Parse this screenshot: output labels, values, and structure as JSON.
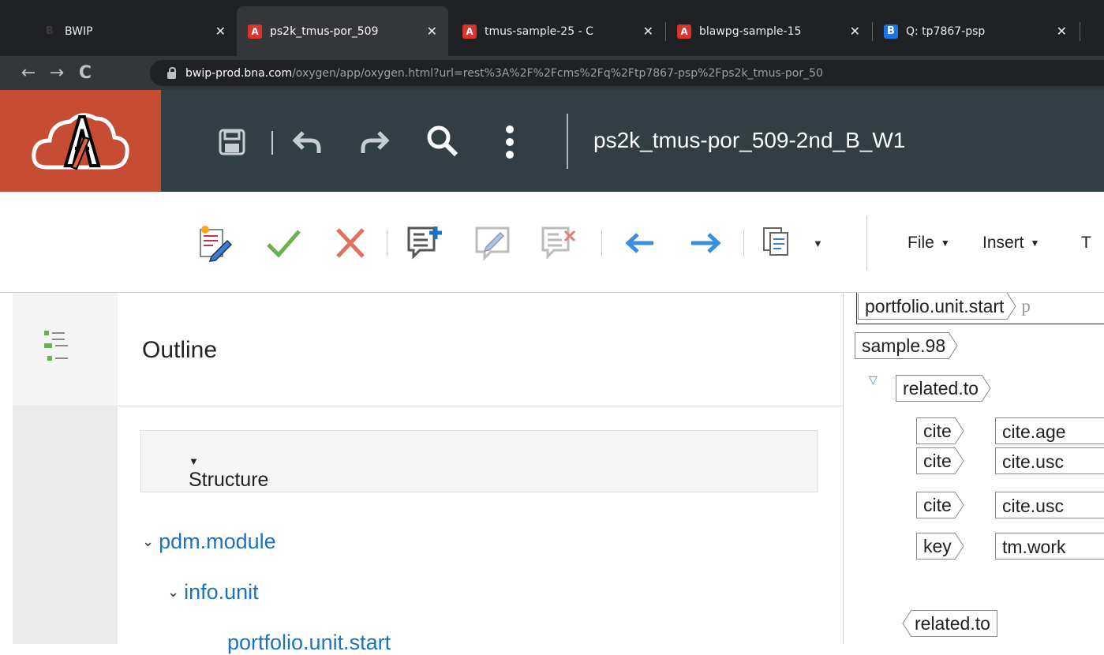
{
  "browser": {
    "tabs": [
      {
        "title": "BWIP",
        "favicon": "b-icon"
      },
      {
        "title": "ps2k_tmus-por_509",
        "favicon": "acrolinx-icon"
      },
      {
        "title": "tmus-sample-25 - C",
        "favicon": "acrolinx-icon"
      },
      {
        "title": "blawpg-sample-15",
        "favicon": "acrolinx-icon"
      },
      {
        "title": "Q: tp7867-psp",
        "favicon": "b-icon"
      }
    ],
    "url_host": "bwip-prod.bna.com",
    "url_path": "/oxygen/app/oxygen.html?url=rest%3A%2F%2Fcms%2Fq%2Ftp7867-psp%2Fps2k_tmus-por_50"
  },
  "header": {
    "doc_title": "ps2k_tmus-por_509-2nd_B_W1",
    "brand_color": "#c64d33",
    "bg_color": "#323e44"
  },
  "toolbar": {
    "menus": [
      "File",
      "Insert",
      "T"
    ]
  },
  "outline": {
    "title": "Outline",
    "structure_label": "Structure",
    "tree": [
      {
        "label": "pdm.module"
      },
      {
        "label": "info.unit"
      },
      {
        "label": "portfolio.unit.start"
      }
    ]
  },
  "editor": {
    "tags": {
      "portfolio_unit_start": "portfolio.unit.start",
      "p_frag": "p",
      "sample": "sample.98",
      "related_to": "related.to",
      "cite1": "cite",
      "cite1_val": "cite.age",
      "cite2": "cite",
      "cite2_val": "cite.usc",
      "cite3": "cite",
      "cite3_val": "cite.usc",
      "key": "key",
      "key_val": "tm.work",
      "related_to_end": "related.to"
    }
  }
}
